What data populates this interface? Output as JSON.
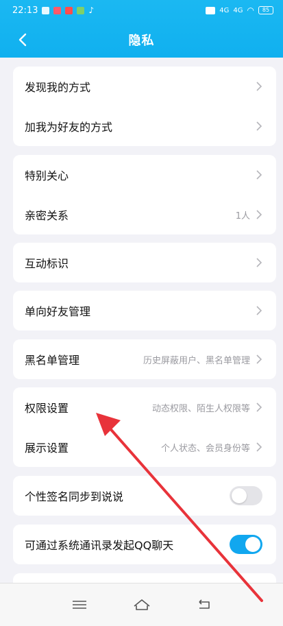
{
  "status_bar": {
    "time": "22:13",
    "network_1": "4G",
    "network_2": "4G",
    "battery": "85"
  },
  "header": {
    "title": "隐私"
  },
  "sections": {
    "discover": [
      {
        "label": "发现我的方式"
      },
      {
        "label": "加我为好友的方式"
      }
    ],
    "relations": [
      {
        "label": "特别关心"
      },
      {
        "label": "亲密关系",
        "hint": "1人"
      }
    ],
    "interaction": {
      "label": "互动标识"
    },
    "oneway": {
      "label": "单向好友管理"
    },
    "blacklist": {
      "label": "黑名单管理",
      "hint": "历史屏蔽用户、黑名单管理"
    },
    "permissions": [
      {
        "label": "权限设置",
        "hint": "动态权限、陌生人权限等"
      },
      {
        "label": "展示设置",
        "hint": "个人状态、会员身份等"
      }
    ],
    "signature_sync": {
      "label": "个性签名同步到说说",
      "enabled": false
    },
    "contacts_chat": {
      "label": "可通过系统通讯录发起QQ聊天",
      "enabled": true
    }
  },
  "colors": {
    "header_blue": "#1bb8f2",
    "toggle_on": "#11a7ef",
    "annotation_arrow": "#e8333a"
  },
  "icons": [
    "back-icon",
    "chevron-right-icon",
    "menu-icon",
    "home-icon",
    "back-nav-icon"
  ]
}
